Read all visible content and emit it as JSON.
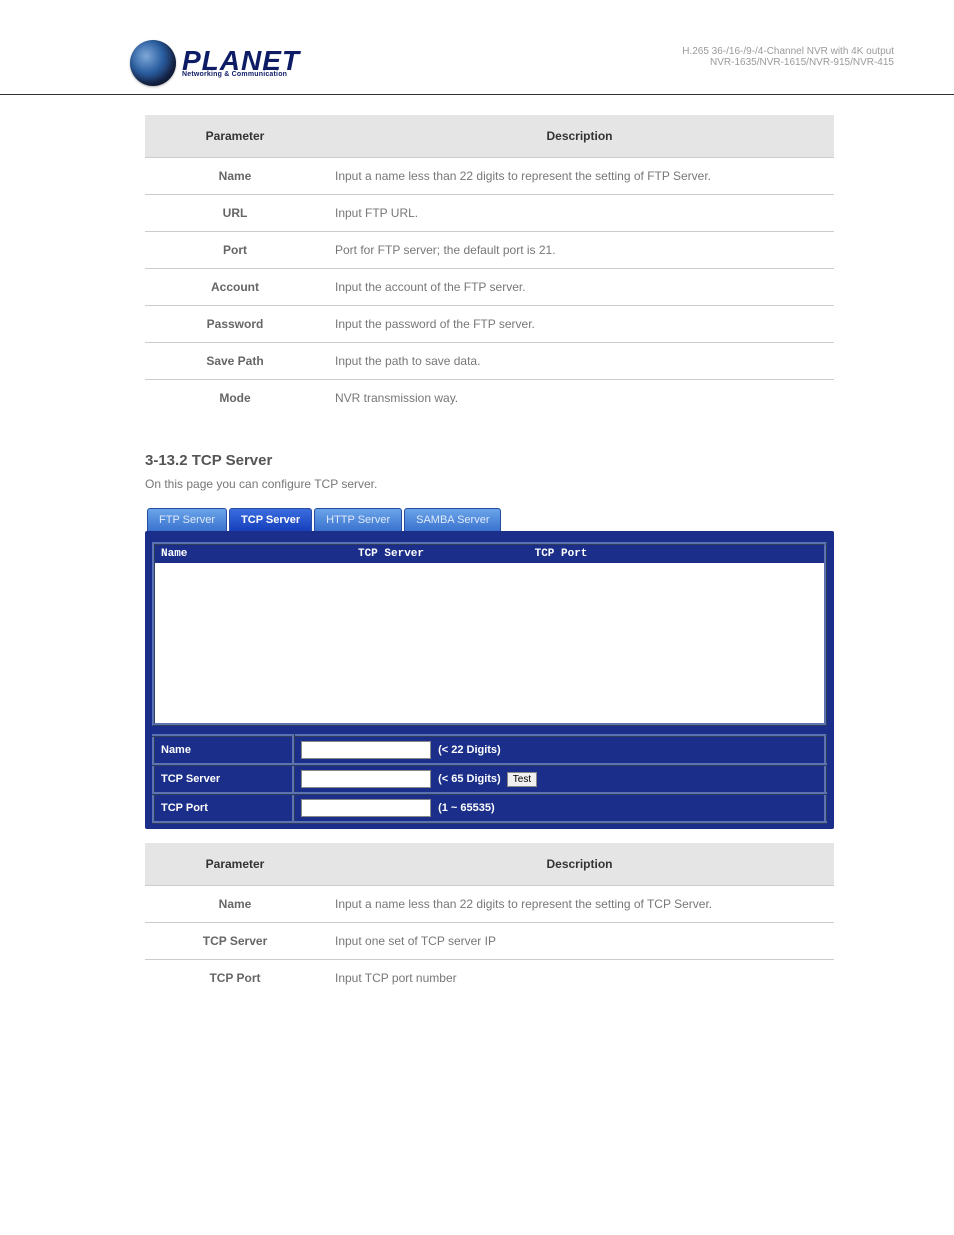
{
  "header": {
    "brand": "PLANET",
    "tagline": "Networking & Communication",
    "device_line1": "H.265 36-/16-/9-/4-Channel NVR with 4K output",
    "device_line2": "NVR-1635/NVR-1615/NVR-915/NVR-415"
  },
  "table1": {
    "headers": {
      "param": "Parameter",
      "desc": "Description"
    },
    "rows": [
      {
        "param": "Name",
        "desc": "Input a name less than 22 digits to represent the setting of FTP Server."
      },
      {
        "param": "URL",
        "desc": "Input FTP URL."
      },
      {
        "param": "Port",
        "desc": "Port for FTP server; the default port is 21."
      },
      {
        "param": "Account",
        "desc": "Input the account of the FTP server."
      },
      {
        "param": "Password",
        "desc": "Input the password of the FTP server."
      },
      {
        "param": "Save Path",
        "desc": "Input the path to save data."
      },
      {
        "param": "Mode",
        "desc": "NVR transmission way."
      }
    ]
  },
  "section2": {
    "title": "3-13.2 TCP Server",
    "desc": "On this page you can configure TCP server."
  },
  "panel": {
    "tabs": [
      "FTP Server",
      "TCP Server",
      "HTTP Server",
      "SAMBA Server"
    ],
    "active_tab": 1,
    "list_headers": {
      "c1": "Name",
      "c2": "TCP Server",
      "c3": "TCP Port"
    },
    "form": {
      "name": {
        "label": "Name",
        "value": "",
        "hint": "(< 22 Digits)"
      },
      "tcp_server": {
        "label": "TCP Server",
        "value": "",
        "hint": "(< 65 Digits)",
        "test_label": "Test"
      },
      "tcp_port": {
        "label": "TCP Port",
        "value": "",
        "hint": "(1 ~ 65535)"
      }
    }
  },
  "table2": {
    "headers": {
      "param": "Parameter",
      "desc": "Description"
    },
    "rows": [
      {
        "param": "Name",
        "desc": "Input a name less than 22 digits to represent the setting of TCP Server."
      },
      {
        "param": "TCP Server",
        "desc": "Input one set of TCP server IP"
      },
      {
        "param": "TCP Port",
        "desc": "Input TCP port number"
      }
    ]
  }
}
